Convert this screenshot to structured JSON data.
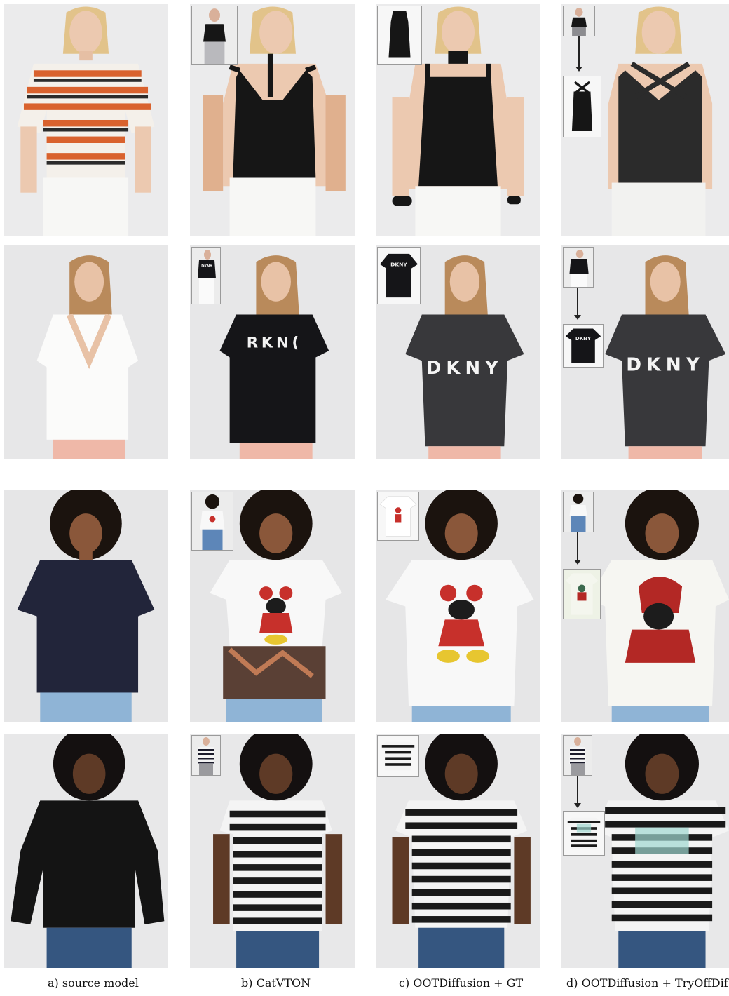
{
  "captions": {
    "source": "a) source model",
    "catvton": "b) CatVTON",
    "ootd_gt": "c) OOTDiffusion + GT",
    "ootd_tryoff": "d) OOTDiffusion + TryOffDif"
  },
  "rows": [
    {
      "garment": "black strappy tank top",
      "source_top": "orange white striped tee"
    },
    {
      "garment": "black DKNY t-shirt",
      "source_top": "white wrap top",
      "prints": {
        "catvton": "RKN(",
        "gt": "DKNY",
        "ootd_gt": "DKNY",
        "tryoff_inset": "DKNY",
        "tryoff": "DKNY"
      }
    },
    {
      "garment": "white Minnie Mouse t-shirt",
      "source_top": "navy t-shirt"
    },
    {
      "garment": "black white striped t-shirt",
      "source_top": "black long sleeve blouse"
    }
  ],
  "colors": {
    "background": "#e9e9ea",
    "skin_light": "#e8c3a8",
    "skin_dark": "#7a4a30",
    "inset_border": "#9a9a9a"
  }
}
